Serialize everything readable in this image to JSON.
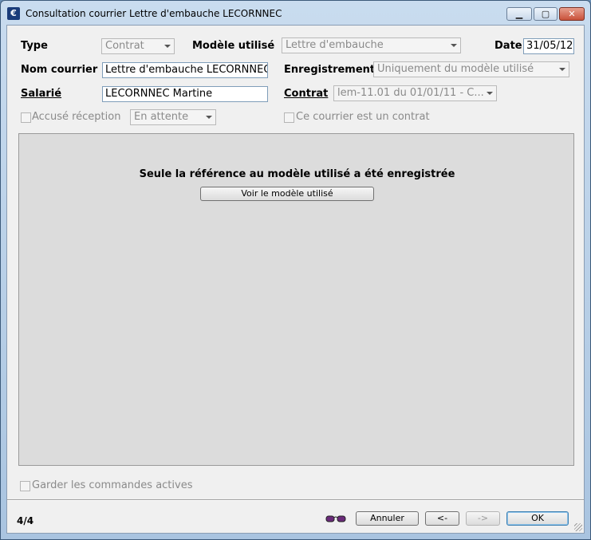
{
  "window": {
    "title": "Consultation courrier Lettre d'embauche LECORNNEC",
    "app_icon": "€",
    "buttons": {
      "minimize": "▁",
      "maximize": "▢",
      "close": "✕"
    }
  },
  "form": {
    "type_label": "Type",
    "type_value": "Contrat",
    "modele_label": "Modèle utilisé",
    "modele_value": "Lettre d'embauche",
    "date_label": "Date",
    "date_value": "31/05/12",
    "nom_label": "Nom courrier",
    "nom_value": "Lettre d'embauche LECORNNEC",
    "enreg_label": "Enregistrement",
    "enreg_value": "Uniquement du modèle utilisé",
    "salarie_label": "Salarié",
    "salarie_value": "LECORNNEC Martine",
    "contrat_label": "Contrat",
    "contrat_value": "lem-11.01 du 01/01/11 - C...",
    "accuse_label": "Accusé réception",
    "accuse_status": "En attente",
    "est_contrat_label": "Ce courrier est un contrat"
  },
  "panel": {
    "message": "Seule la référence au modèle utilisé a été enregistrée",
    "voir_button": "Voir le modèle utilisé"
  },
  "options": {
    "garder_label": "Garder les commandes actives"
  },
  "footer": {
    "page_indicator": "4/4",
    "glasses_icon": "glasses-icon",
    "annuler": "Annuler",
    "prev": "<-",
    "next": "->",
    "ok": "OK"
  }
}
